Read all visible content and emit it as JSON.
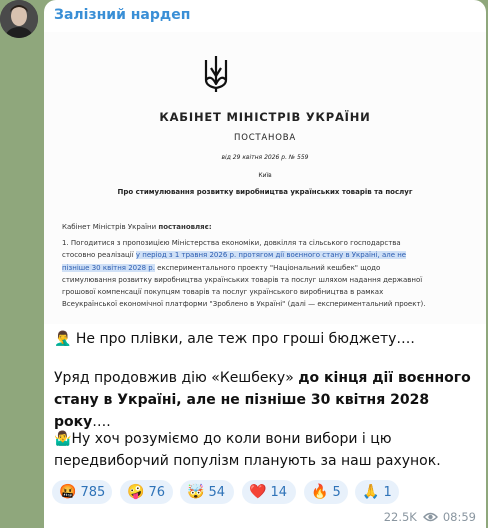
{
  "channel": {
    "name": "Залізний нардеп"
  },
  "document": {
    "title": "КАБІНЕТ МІНІСТРІВ УКРАЇНИ",
    "type": "ПОСТАНОВА",
    "date_line": "від 29 квітня 2026 р. № 559",
    "city": "Київ",
    "subject": "Про стимулювання розвитку виробництва українських товарів та послуг",
    "preamble_text": "Кабінет Міністрів України ",
    "preamble_bold": "постановляє:",
    "para_start": "1. Погодитися з пропозицією Міністерства економіки, довкілля та сільського господарства стосовно реалізації ",
    "para_highlight": "у період з 1 травня 2026 р. протягом дії воєнного стану в Україні, але не пізніше 30 квітня 2028 р.",
    "para_end": " експериментального проекту \"Національний кешбек\" щодо стимулювання розвитку виробництва українських товарів та послуг шляхом надання державної грошової компенсації покупцям товарів та послуг українського виробництва в рамках Всеукраїнської економічної платформи \"Зроблено в Україні\" (далі — експериментальний проект)."
  },
  "message": {
    "line1_emoji": "🤦‍♂️",
    "line1": " Не про плівки, але теж про гроші бюджету….",
    "line2_start": "Уряд продовжив дію «Кешбеку» ",
    "line2_bold": "до кінця дії воєнного стану в Україні, але не пізніше 30 квітня 2028 року",
    "line2_end": "….",
    "line3_emoji": "🤷‍♂️",
    "line3": "Ну хоч розуміємо до коли вони вибори і цю передвиборчий популізм планують за наш рахунок."
  },
  "reactions": [
    {
      "emoji": "🤬",
      "count": "785"
    },
    {
      "emoji": "🤪",
      "count": "76"
    },
    {
      "emoji": "🤯",
      "count": "54"
    },
    {
      "emoji": "❤️",
      "count": "14"
    },
    {
      "emoji": "🔥",
      "count": "5"
    },
    {
      "emoji": "🙏",
      "count": "1"
    }
  ],
  "meta": {
    "views": "22.5K",
    "time": "08:59"
  }
}
